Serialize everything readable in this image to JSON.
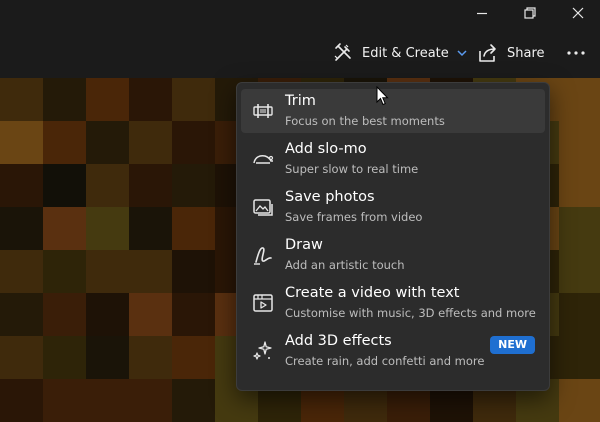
{
  "toolbar": {
    "edit_create_label": "Edit & Create",
    "share_label": "Share"
  },
  "menu": {
    "items": [
      {
        "title": "Trim",
        "subtitle": "Focus on the best moments",
        "icon": "trim-icon"
      },
      {
        "title": "Add slo-mo",
        "subtitle": "Super slow to real time",
        "icon": "slo-mo-icon"
      },
      {
        "title": "Save photos",
        "subtitle": "Save frames from video",
        "icon": "save-photos-icon"
      },
      {
        "title": "Draw",
        "subtitle": "Add an artistic touch",
        "icon": "draw-icon"
      },
      {
        "title": "Create a video with text",
        "subtitle": "Customise with music, 3D effects and more",
        "icon": "video-text-icon"
      },
      {
        "title": "Add 3D effects",
        "subtitle": "Create rain, add confetti and more",
        "icon": "3d-effects-icon",
        "badge": "NEW"
      }
    ]
  },
  "colors": {
    "menu_bg": "#2c2c2c",
    "badge": "#1f6fd1",
    "app_bg": "#1b1b1b"
  }
}
